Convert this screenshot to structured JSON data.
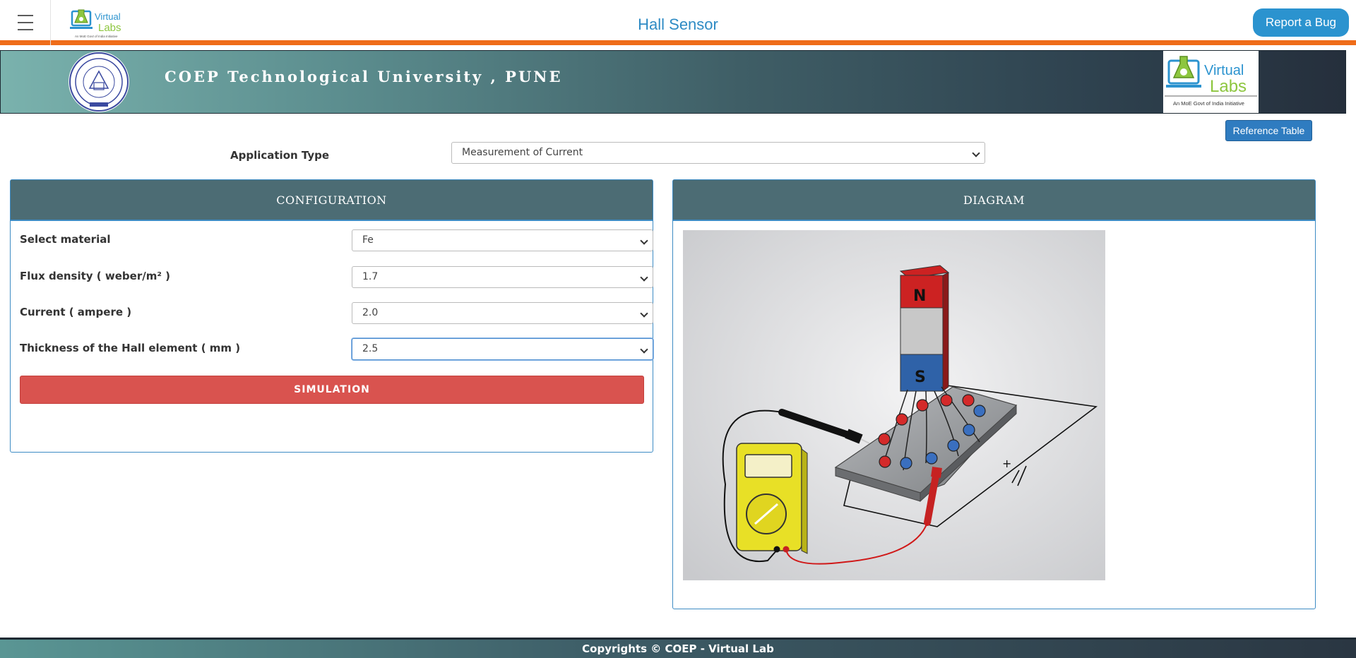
{
  "nav": {
    "title": "Hall Sensor",
    "report_bug": "Report a Bug",
    "logo_text_top": "Virtual",
    "logo_text_bottom": "Labs",
    "logo_tagline": "An MoE Govt of India Initiative"
  },
  "banner": {
    "title": "COEP Technological University , PUNE",
    "logo_right_top": "Virtual",
    "logo_right_bottom": "Labs",
    "logo_right_tagline": "An MoE Govt of India Initiative"
  },
  "reference_table": "Reference Table",
  "application": {
    "label": "Application Type",
    "value": "Measurement of Current"
  },
  "config": {
    "header": "CONFIGURATION",
    "fields": [
      {
        "label": "Select material",
        "value": "Fe"
      },
      {
        "label": "Flux density ( weber/m² )",
        "value": "1.7"
      },
      {
        "label": "Current ( ampere )",
        "value": "2.0"
      },
      {
        "label": "Thickness of the Hall element ( mm )",
        "value": "2.5"
      }
    ],
    "simulate": "SIMULATION"
  },
  "diagram": {
    "header": "DIAGRAM",
    "magnet_n": "N",
    "magnet_s": "S"
  },
  "footer": "Copyrights © COEP - Virtual Lab",
  "colors": {
    "accent_orange": "#ef6c19",
    "nav_blue": "#2e8bc4",
    "panel_head": "#4c6c74",
    "sim_red": "#d9534f"
  }
}
